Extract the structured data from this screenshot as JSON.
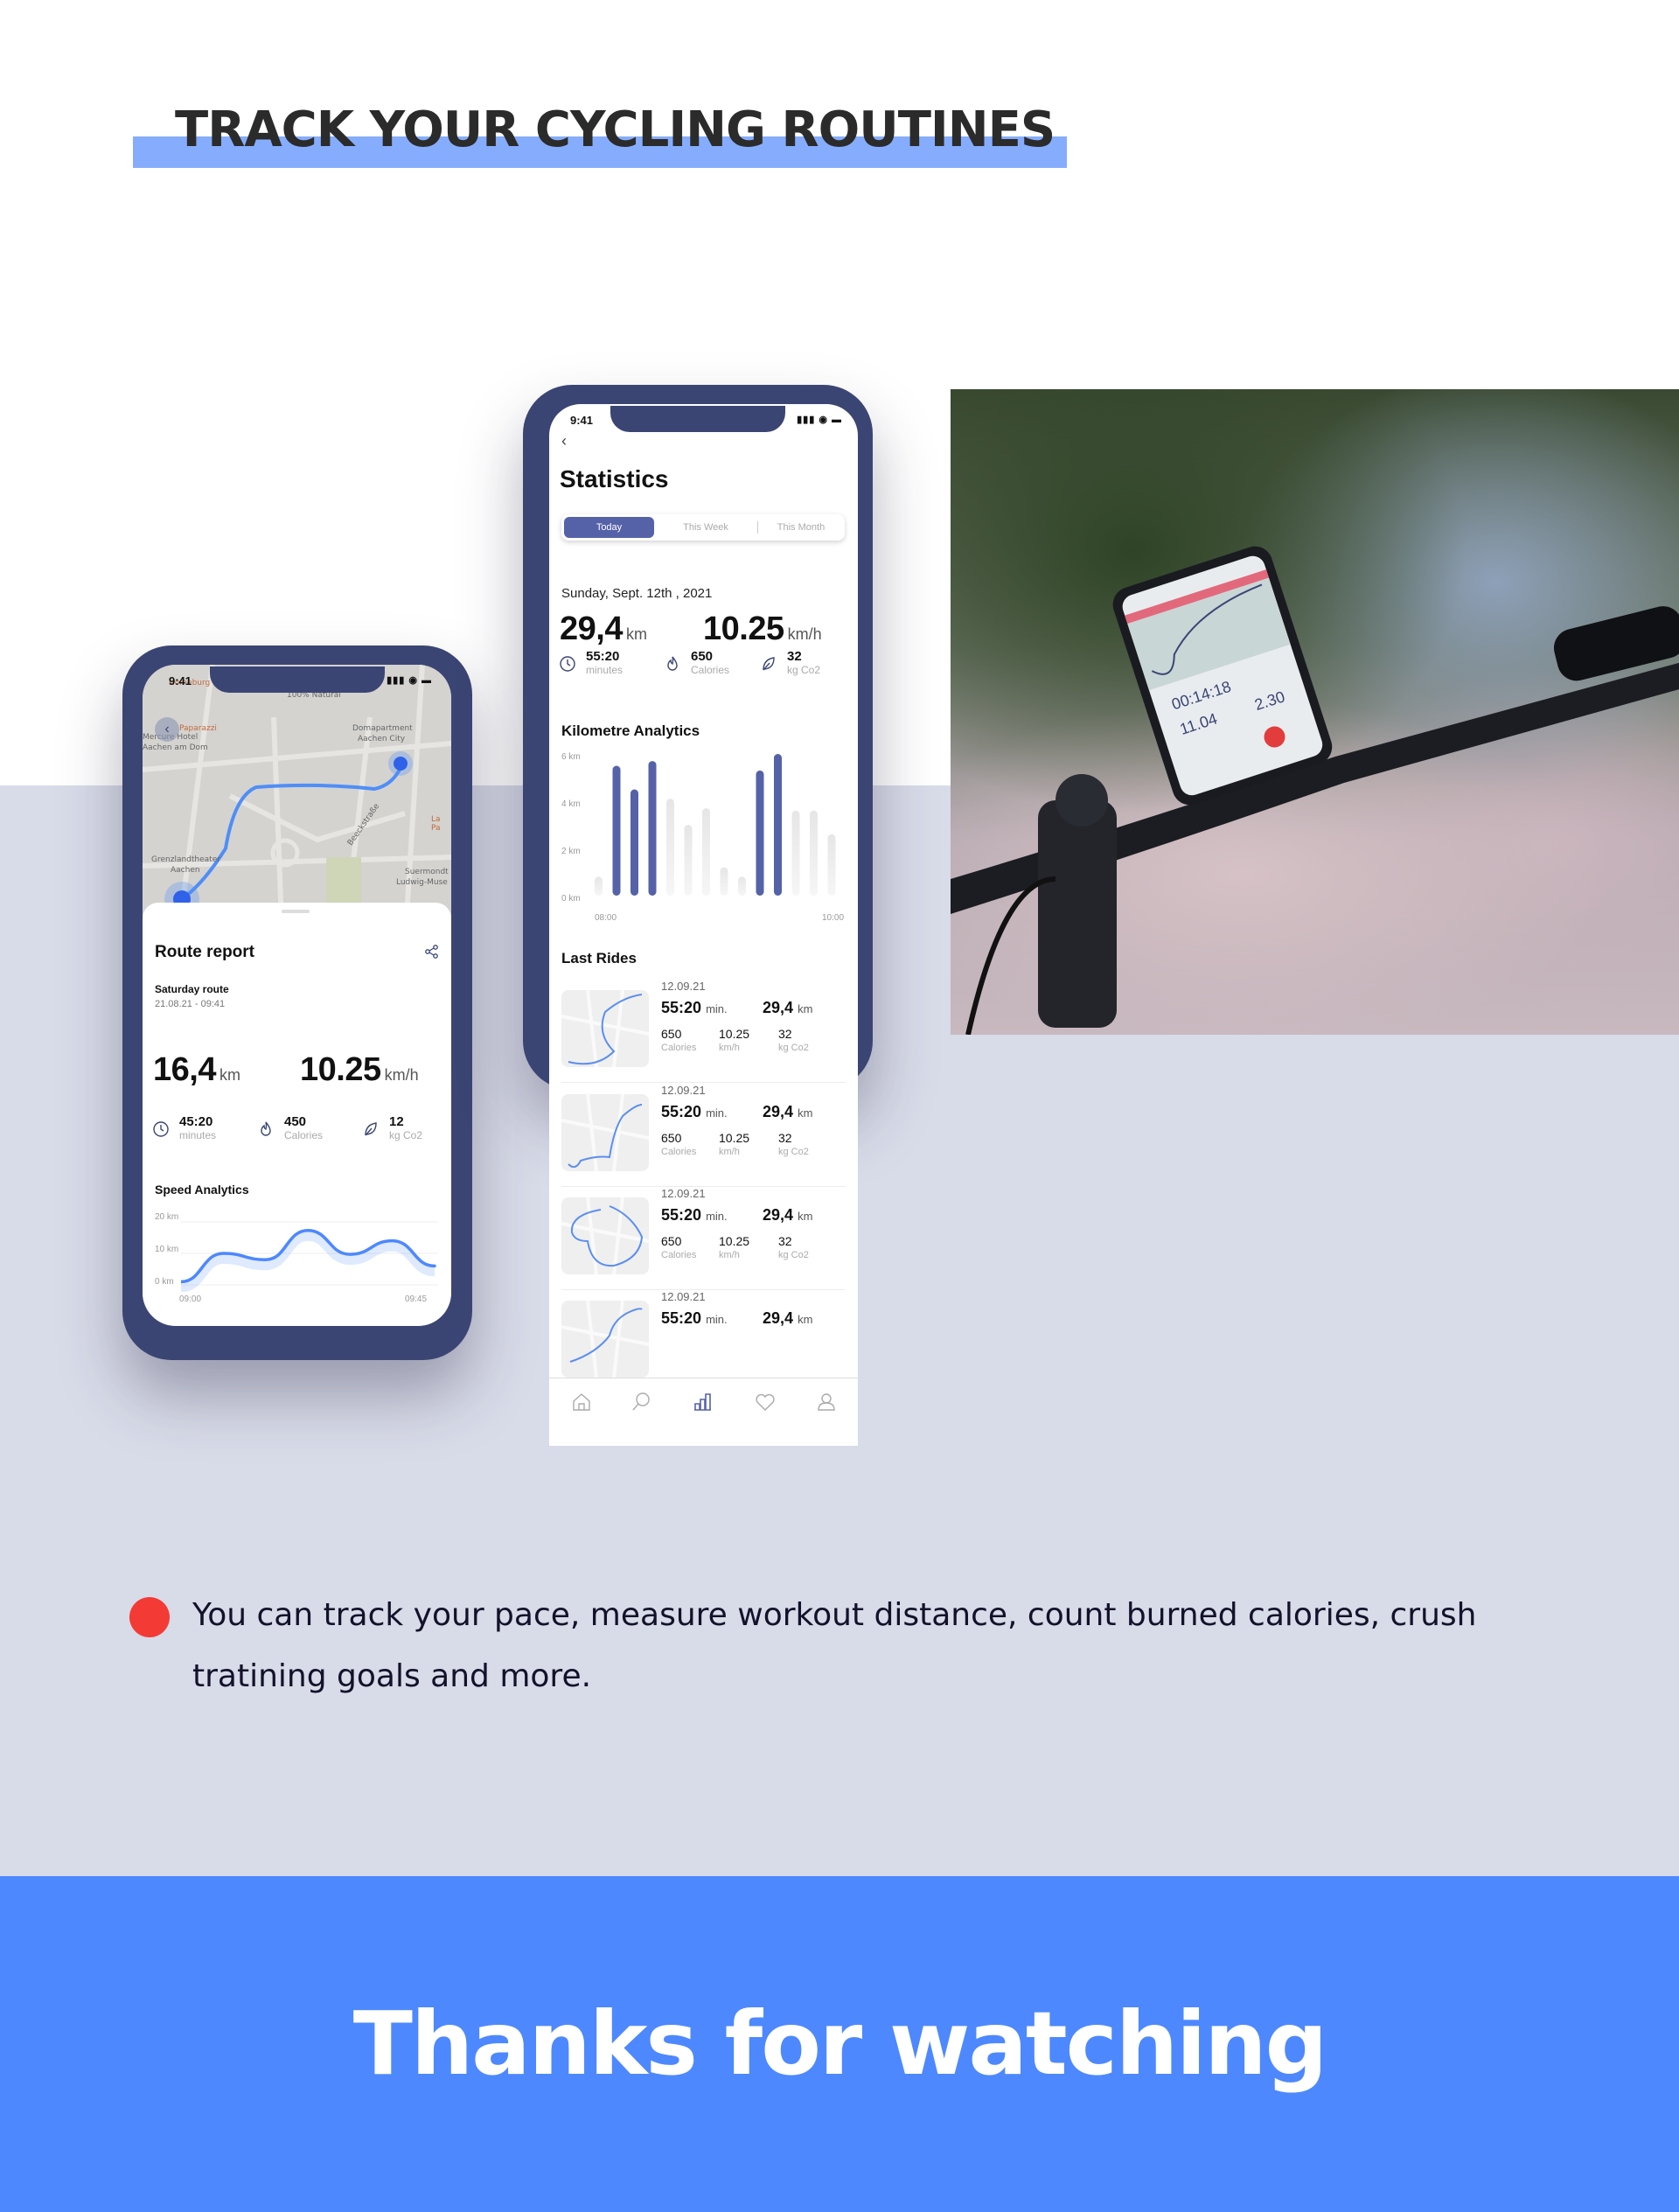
{
  "header": {
    "title": "TRACK YOUR CYCLING ROUTINES"
  },
  "colors": {
    "accent_blue": "#4d88fe",
    "highlight_bar": "#86adfd",
    "phone_frame": "#3b4574",
    "primary": "#5562a8",
    "bullet": "#f43a34",
    "band": "#d8dbe8"
  },
  "left_phone": {
    "status_time": "9:41",
    "map": {
      "labels": [
        "Homeburg",
        "Paparazzi",
        "100% Natural",
        "Domapartment",
        "Aachen City",
        "Mercure Hotel",
        "Aachen am Dom",
        "Beeckstraße",
        "La Pa",
        "Grenzlandtheater",
        "Aachen",
        "Suermondt",
        "Ludwig-Muse"
      ],
      "back_icon": "chevron-left-icon"
    },
    "route_report": {
      "title": "Route report",
      "share_icon": "share-icon",
      "route_name": "Saturday route",
      "route_datetime": "21.08.21 - 09:41",
      "distance": "16,4",
      "distance_unit": "km",
      "speed": "10.25",
      "speed_unit": "km/h",
      "stats": [
        {
          "icon": "clock-icon",
          "value": "45:20",
          "label": "minutes"
        },
        {
          "icon": "flame-icon",
          "value": "450",
          "label": "Calories"
        },
        {
          "icon": "leaf-icon",
          "value": "12",
          "label": "kg Co2"
        }
      ],
      "speed_title": "Speed Analytics"
    }
  },
  "right_phone": {
    "status_time": "9:41",
    "title": "Statistics",
    "tabs": [
      {
        "label": "Today",
        "active": true
      },
      {
        "label": "This Week",
        "active": false
      },
      {
        "label": "This Month",
        "active": false
      }
    ],
    "date": "Sunday, Sept. 12th , 2021",
    "distance": "29,4",
    "distance_unit": "km",
    "speed": "10.25",
    "speed_unit": "km/h",
    "stats": [
      {
        "icon": "clock-icon",
        "value": "55:20",
        "label": "minutes"
      },
      {
        "icon": "flame-icon",
        "value": "650",
        "label": "Calories"
      },
      {
        "icon": "leaf-icon",
        "value": "32",
        "label": "kg Co2"
      }
    ],
    "km_title": "Kilometre Analytics",
    "last_rides_title": "Last Rides",
    "rides": [
      {
        "date": "12.09.21",
        "time": "55:20",
        "time_unit": "min.",
        "distance": "29,4",
        "distance_unit": "km",
        "calories": "650",
        "calories_label": "Calories",
        "speed": "10.25",
        "speed_label": "km/h",
        "co2": "32",
        "co2_label": "kg Co2"
      },
      {
        "date": "12.09.21",
        "time": "55:20",
        "time_unit": "min.",
        "distance": "29,4",
        "distance_unit": "km",
        "calories": "650",
        "calories_label": "Calories",
        "speed": "10.25",
        "speed_label": "km/h",
        "co2": "32",
        "co2_label": "kg Co2"
      },
      {
        "date": "12.09.21",
        "time": "55:20",
        "time_unit": "min.",
        "distance": "29,4",
        "distance_unit": "km",
        "calories": "650",
        "calories_label": "Calories",
        "speed": "10.25",
        "speed_label": "km/h",
        "co2": "32",
        "co2_label": "kg Co2"
      },
      {
        "date": "12.09.21",
        "time": "55:20",
        "time_unit": "min.",
        "distance": "29,4",
        "distance_unit": "km"
      }
    ],
    "tabbar": [
      {
        "icon": "home-icon",
        "active": false
      },
      {
        "icon": "search-icon",
        "active": false
      },
      {
        "icon": "bar-chart-icon",
        "active": true
      },
      {
        "icon": "heart-icon",
        "active": false
      },
      {
        "icon": "user-icon",
        "active": false
      }
    ]
  },
  "photo": {
    "subject": "bike handlebar with phone mount",
    "phone_readout": [
      "00:14:18",
      "11.04",
      "2.30"
    ]
  },
  "description": "You can track your pace, measure workout distance, count burned calories, crush tratining goals and more.",
  "footer": {
    "title": "Thanks for watching"
  },
  "chart_data": [
    {
      "type": "bar",
      "title": "Kilometre Analytics",
      "ylabel": "",
      "ylim": [
        0,
        6
      ],
      "yticks": [
        "0 km",
        "2 km",
        "4 km",
        "6 km"
      ],
      "xticks": [
        "08:00",
        "10:00"
      ],
      "values": [
        0.8,
        5.5,
        4.5,
        5.7,
        4.1,
        3.0,
        3.7,
        1.2,
        0.8,
        5.3,
        6.0,
        3.6,
        3.6,
        2.6
      ],
      "highlighted": [
        false,
        true,
        true,
        true,
        false,
        false,
        false,
        false,
        false,
        true,
        true,
        false,
        false,
        false
      ],
      "grid": false
    },
    {
      "type": "line",
      "title": "Speed Analytics",
      "ylim": [
        0,
        20
      ],
      "yticks": [
        "0 km",
        "10 km",
        "20 km"
      ],
      "xticks": [
        "09:00",
        "09:45"
      ],
      "values": [
        1,
        10,
        8,
        17.3,
        9.7,
        14,
        6
      ],
      "grid": true
    }
  ]
}
